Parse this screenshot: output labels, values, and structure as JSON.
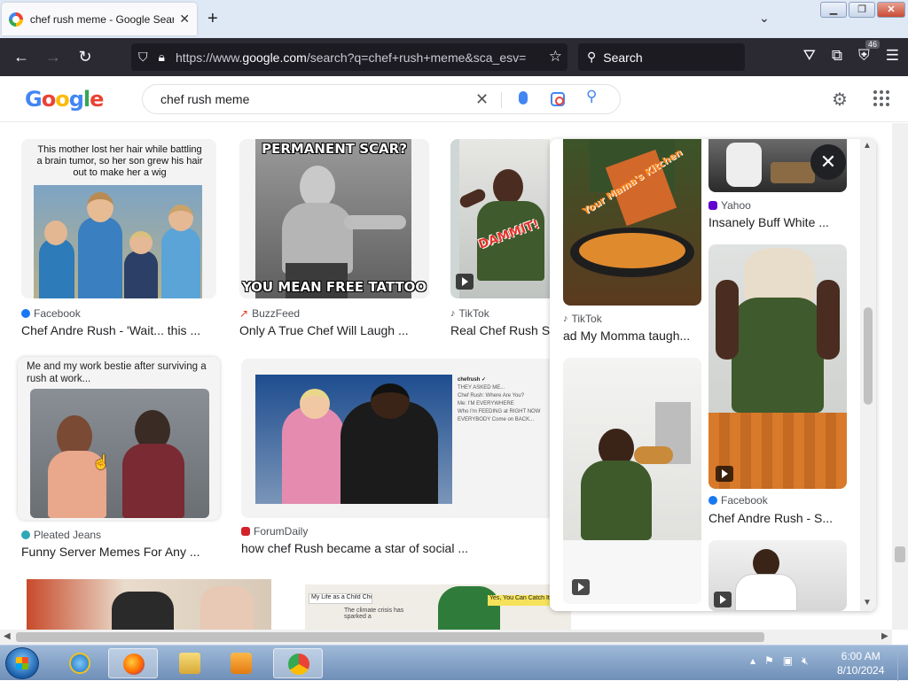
{
  "browser": {
    "tab_title": "chef rush meme - Google Search",
    "url_host_prefix": "https://www.",
    "url_host": "google.com",
    "url_rest": "/search?q=chef+rush+meme&sca_esv=",
    "search_placeholder": "Search",
    "extension_badge": "46"
  },
  "google": {
    "logo_letters": [
      "G",
      "o",
      "o",
      "g",
      "l",
      "e"
    ],
    "query": "chef rush meme"
  },
  "results": [
    {
      "source": "Facebook",
      "source_color": "#1877f2",
      "title": "Chef Andre Rush - 'Wait... this ...",
      "caption": "This mother lost her hair while battling a brain tumor, so her son grew his hair out to make her a wig"
    },
    {
      "source": "BuzzFeed",
      "source_color": "#ee3322",
      "title": "Only A True Chef Will Laugh ...",
      "caption_top": "PERMANENT SCAR?",
      "caption_bottom": "YOU MEAN FREE TATTOO"
    },
    {
      "source": "TikTok",
      "source_color": "#000000",
      "title": "Real Chef Rush S...",
      "caption": "DAMMIT!"
    },
    {
      "source": "Pleated Jeans",
      "source_color": "#2ea8b8",
      "title": "Funny Server Memes For Any ...",
      "caption": "Me and my work bestie after surviving a rush at work..."
    },
    {
      "source": "ForumDaily",
      "source_color": "#d2232a",
      "title": "how chef Rush became a star of social ..."
    },
    {
      "caption": "My Life as a Child Chef"
    },
    {
      "caption_left": "The climate crisis has sparked a",
      "caption_right": "Yes, You Can Catch It"
    }
  ],
  "panel": {
    "items": [
      {
        "source": "TikTok",
        "source_color": "#000000",
        "title": "ad My Momma taugh...",
        "caption": "Your Mama's Kitchen"
      },
      {
        "source": "Yahoo",
        "source_color": "#6001d2",
        "title": "Insanely Buff White ..."
      },
      {
        "source": "Facebook",
        "source_color": "#1877f2",
        "title": "Chef Andre Rush - S..."
      }
    ]
  },
  "taskbar": {
    "time": "6:00 AM",
    "date": "8/10/2024"
  }
}
